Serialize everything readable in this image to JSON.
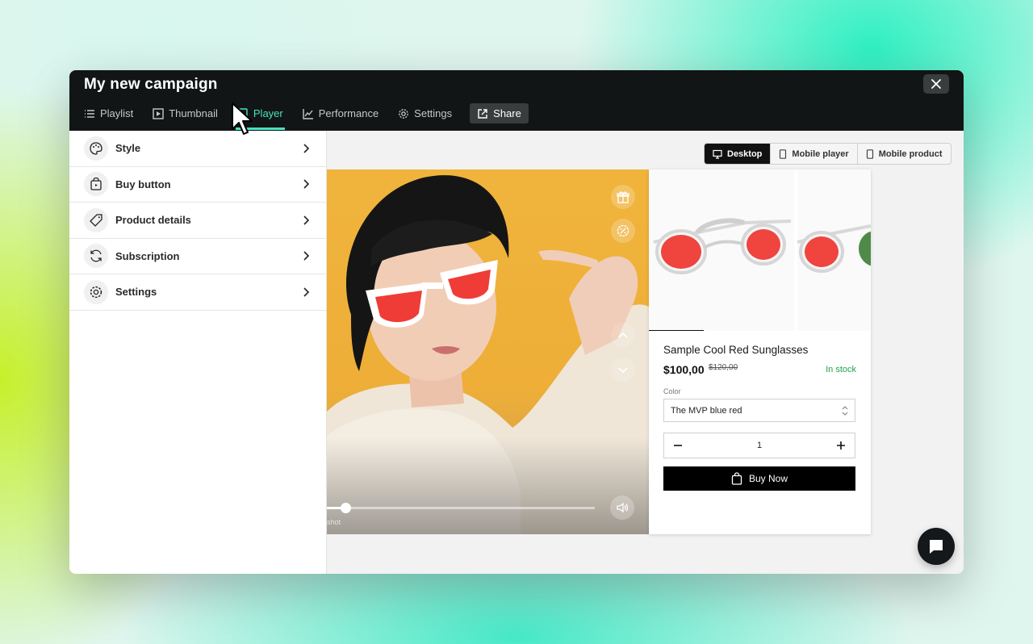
{
  "window": {
    "title": "My new campaign",
    "tabs": [
      {
        "label": "Playlist",
        "icon": "list-icon"
      },
      {
        "label": "Thumbnail",
        "icon": "play-square-icon"
      },
      {
        "label": "Player",
        "icon": "player-icon",
        "active": true
      },
      {
        "label": "Performance",
        "icon": "chart-line-icon"
      },
      {
        "label": "Settings",
        "icon": "gear-icon"
      },
      {
        "label": "Share",
        "icon": "external-link-icon"
      }
    ]
  },
  "sidebar": {
    "items": [
      {
        "label": "Style",
        "icon": "palette-icon"
      },
      {
        "label": "Buy button",
        "icon": "shopping-bag-icon"
      },
      {
        "label": "Product details",
        "icon": "tag-icon"
      },
      {
        "label": "Subscription",
        "icon": "refresh-icon"
      },
      {
        "label": "Settings",
        "icon": "gear-icon"
      }
    ]
  },
  "devices": {
    "options": [
      "Desktop",
      "Mobile player",
      "Mobile product"
    ],
    "selected": "Desktop"
  },
  "video": {
    "progress": 0.07,
    "watermark": "shot"
  },
  "product": {
    "name": "Sample Cool Red Sunglasses",
    "price": "$100,00",
    "old_price": "$120,00",
    "stock": "In stock",
    "color_label": "Color",
    "color_value": "The MVP blue red",
    "quantity": "1",
    "buy_label": "Buy Now"
  },
  "colors": {
    "accent": "#46e3c0",
    "header_bg": "#121515",
    "stock_green": "#1fa64c",
    "lens_red": "#f0443e"
  }
}
